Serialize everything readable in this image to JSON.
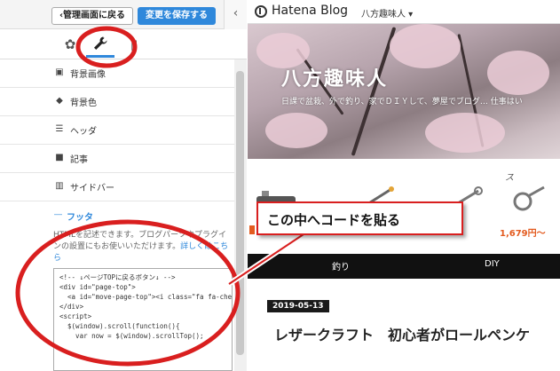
{
  "editor": {
    "back_label": "‹管理画面に戻る",
    "save_label": "変更を保存する",
    "collapse_label": "‹",
    "menu": [
      {
        "label": "背景画像",
        "icon": "image-icon"
      },
      {
        "label": "背景色",
        "icon": "paint-bucket-icon"
      },
      {
        "label": "ヘッダ",
        "icon": "header-icon"
      },
      {
        "label": "記事",
        "icon": "article-icon"
      },
      {
        "label": "サイドバー",
        "icon": "sidebar-icon"
      }
    ],
    "footer": {
      "title": "フッタ",
      "description": "HTMLを記述できます。ブログパーツやプラグインの設置にもお使いいただけます。",
      "link": "詳しくはこちら",
      "code": "<!-- ↓ページTOPに戻るボタン↓ -->\n<div id=\"page-top\">\n  <a id=\"move-page-top\"><i class=\"fa fa-chevro\n</div>\n<script>\n  $(window).scroll(function(){\n    var now = $(window).scrollTop();"
    }
  },
  "preview": {
    "brand": "Hatena Blog",
    "blog_dropdown": "八方趣味人 ▾",
    "blog_title": "八方趣味人",
    "blog_description": "日課で盆栽、外で釣り、家でＤＩＹして、夢屋でブログ… 仕事はい",
    "products_label": "ス",
    "price": "1,679円～",
    "nav": [
      "釣り",
      "DIY"
    ],
    "article_date": "2019-05-13",
    "article_title": "レザークラフト　初心者がロールペンケ"
  },
  "annotation": {
    "callout": "この中へコードを貼る"
  },
  "colors": {
    "accent": "#2f88db",
    "annotation_red": "#d91f1f",
    "price_orange": "#e35b1f"
  }
}
